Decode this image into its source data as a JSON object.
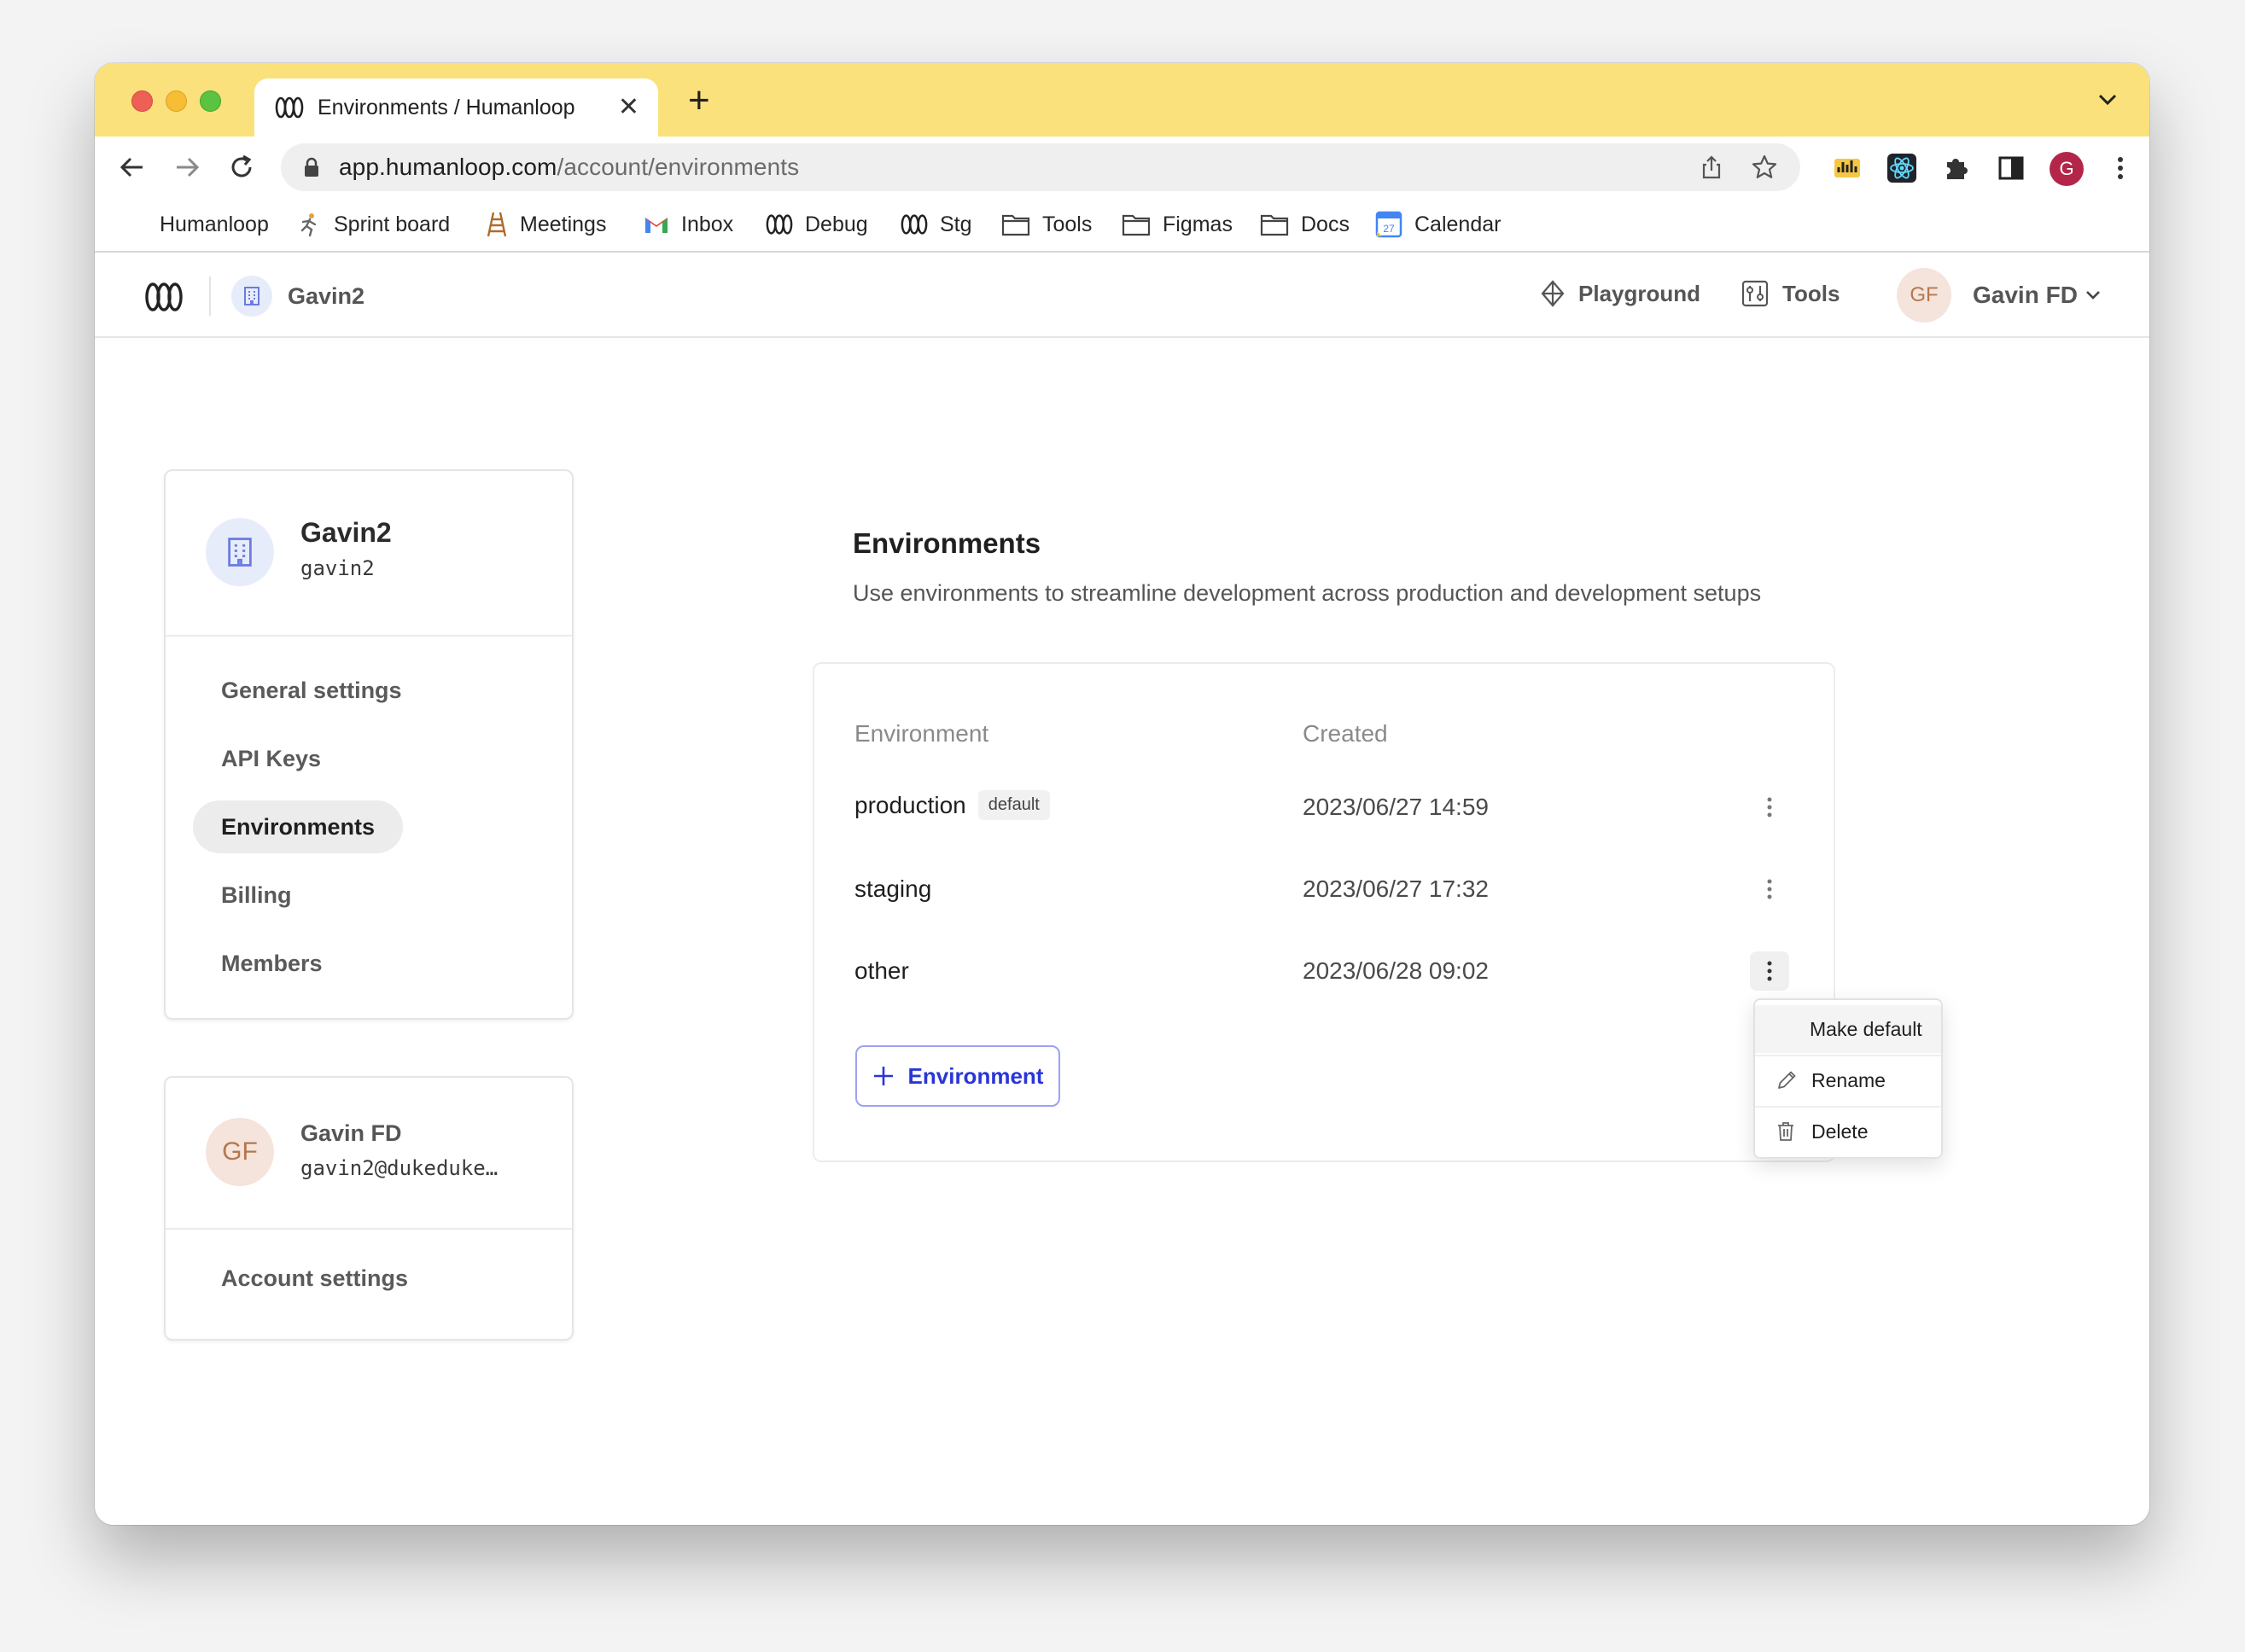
{
  "browser": {
    "tab_title": "Environments / Humanloop",
    "tab_close": "✕",
    "new_tab": "+",
    "url_host": "app.humanloop.com",
    "url_path": "/account/environments",
    "profile_initial": "G",
    "bookmarks": [
      {
        "label": "Humanloop",
        "icon": "none"
      },
      {
        "label": "Sprint board",
        "icon": "runner-icon"
      },
      {
        "label": "Meetings",
        "icon": "ladder-icon"
      },
      {
        "label": "Inbox",
        "icon": "gmail-icon"
      },
      {
        "label": "Debug",
        "icon": "humanloop-logo-icon"
      },
      {
        "label": "Stg",
        "icon": "humanloop-logo-icon"
      },
      {
        "label": "Tools",
        "icon": "folder-icon"
      },
      {
        "label": "Figmas",
        "icon": "folder-icon"
      },
      {
        "label": "Docs",
        "icon": "folder-icon"
      },
      {
        "label": "Calendar",
        "icon": "calendar-icon",
        "calendar_day": "27"
      }
    ]
  },
  "header": {
    "org_name": "Gavin2",
    "playground_label": "Playground",
    "tools_label": "Tools",
    "user_initials": "GF",
    "user_name": "Gavin FD"
  },
  "sidebar": {
    "org_card": {
      "name": "Gavin2",
      "slug": "gavin2",
      "items": [
        {
          "label": "General settings",
          "active": false
        },
        {
          "label": "API Keys",
          "active": false
        },
        {
          "label": "Environments",
          "active": true
        },
        {
          "label": "Billing",
          "active": false
        },
        {
          "label": "Members",
          "active": false
        }
      ]
    },
    "user_card": {
      "initials": "GF",
      "name": "Gavin FD",
      "email": "gavin2@dukeduke…",
      "account_settings_label": "Account settings"
    }
  },
  "main": {
    "title": "Environments",
    "description": "Use environments to streamline development across production and development setups",
    "table": {
      "columns": [
        "Environment",
        "Created"
      ],
      "rows": [
        {
          "name": "production",
          "badge": "default",
          "created": "2023/06/27 14:59"
        },
        {
          "name": "staging",
          "badge": "",
          "created": "2023/06/27 17:32"
        },
        {
          "name": "other",
          "badge": "",
          "created": "2023/06/28 09:02"
        }
      ]
    },
    "add_button_label": "Environment"
  },
  "dropdown": {
    "items": [
      "Make default",
      "Rename",
      "Delete"
    ]
  },
  "colors": {
    "tabstrip": "#fae17b",
    "accent": "#2a35d8",
    "avatar_peach": "#f5e4db",
    "org_avatar": "#e7ecfb"
  }
}
